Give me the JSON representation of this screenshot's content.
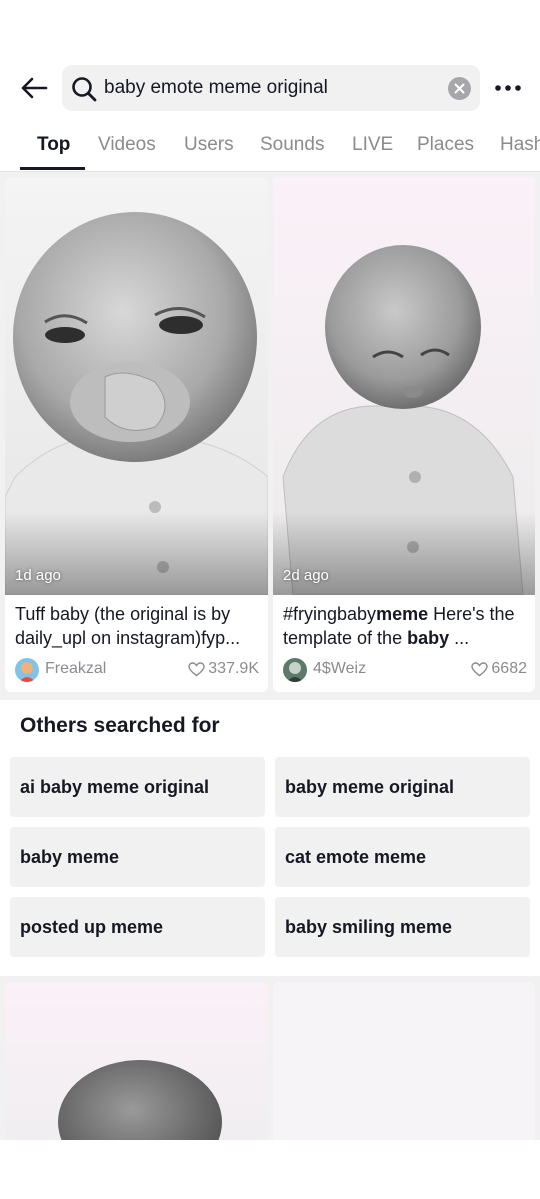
{
  "search": {
    "query": "baby emote meme original"
  },
  "tabs": [
    {
      "label": "Top",
      "active": true
    },
    {
      "label": "Videos"
    },
    {
      "label": "Users"
    },
    {
      "label": "Sounds"
    },
    {
      "label": "LIVE"
    },
    {
      "label": "Places"
    },
    {
      "label": "Hashtags"
    }
  ],
  "videos": [
    {
      "time_ago": "1d ago",
      "title": "Tuff baby (the original is by daily_upl on instagram)fyp...",
      "author": "Freakzal",
      "likes": "337.9K"
    },
    {
      "time_ago": "2d ago",
      "title_parts": [
        "#fryingbaby",
        "meme",
        " Here's the template of the ",
        "baby",
        " ..."
      ],
      "author": "4$Weiz",
      "likes": "6682"
    }
  ],
  "others": {
    "title": "Others searched for",
    "items": [
      "ai baby meme original",
      "baby meme original",
      "baby meme",
      "cat emote meme",
      "posted up meme",
      "baby smiling meme"
    ]
  },
  "colors": {
    "text": "#161823",
    "muted": "#8a8b91",
    "surface": "#f1f1f2"
  },
  "icons": [
    "back-arrow-icon",
    "search-icon",
    "clear-icon",
    "more-icon",
    "heart-icon"
  ]
}
